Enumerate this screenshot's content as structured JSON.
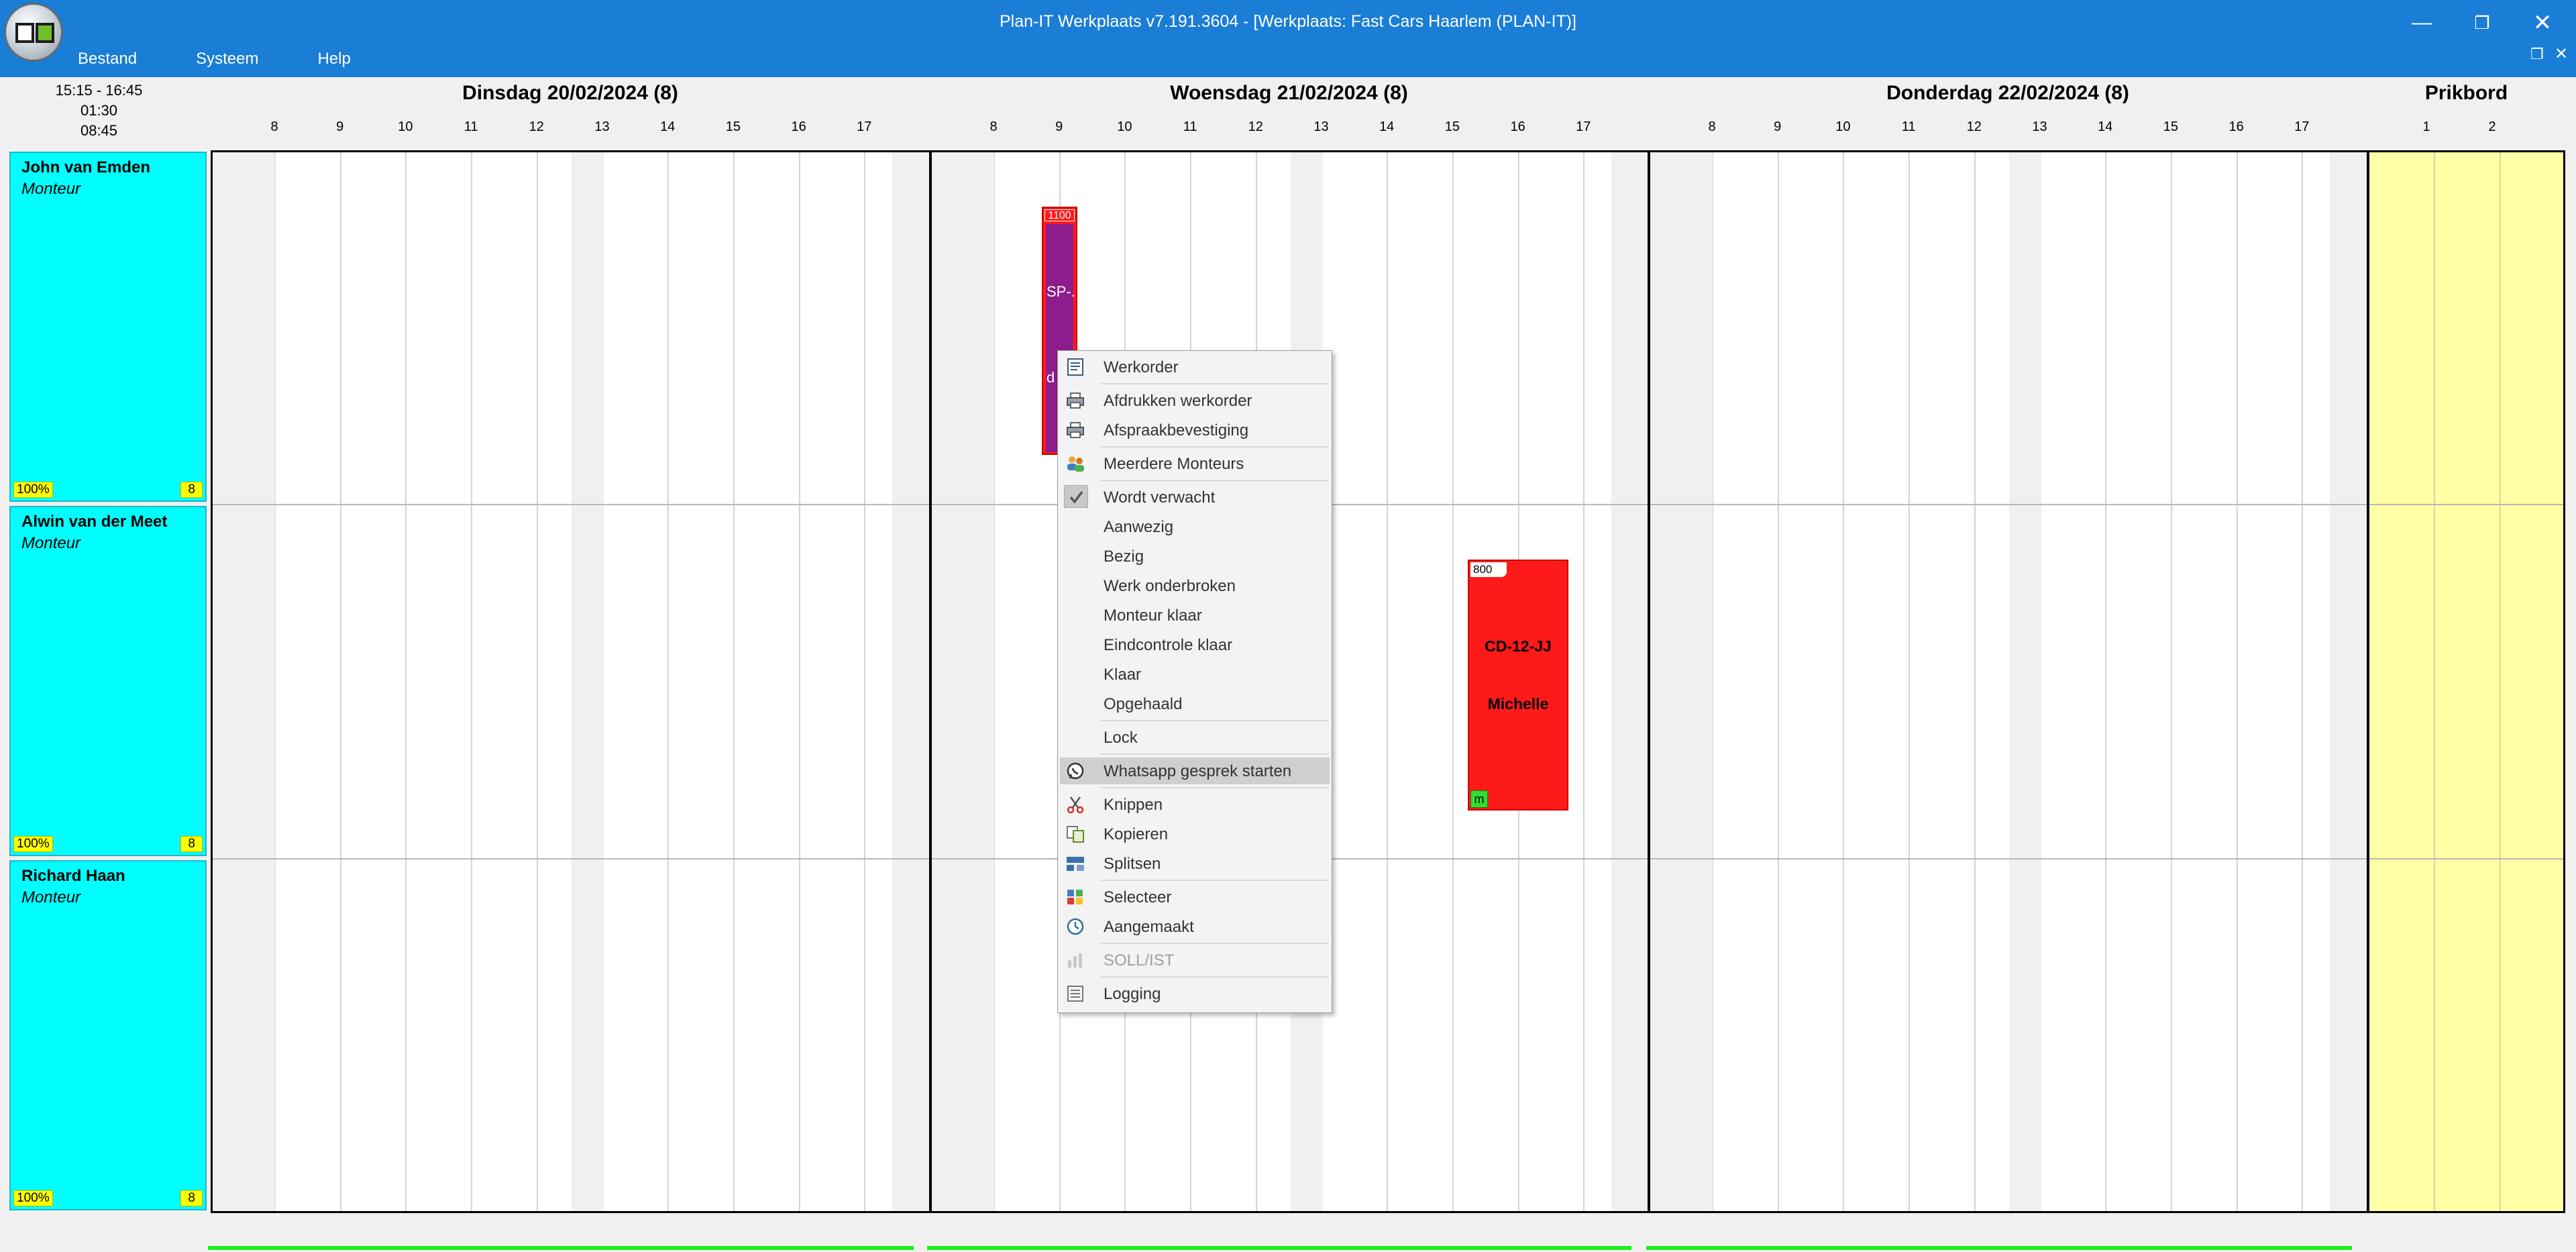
{
  "window": {
    "title": "Plan-IT Werkplaats v7.191.3604 - [Werkplaats: Fast Cars Haarlem (PLAN-IT)]",
    "minimize_glyph": "—",
    "maximize_glyph": "❐",
    "close_glyph": "✕",
    "mdi_restore_glyph": "❐",
    "mdi_close_glyph": "✕"
  },
  "menu": [
    "Bestand",
    "Systeem",
    "Help"
  ],
  "time_info": {
    "range": "15:15 - 16:45",
    "duration": "01:30",
    "current": "08:45"
  },
  "days": [
    {
      "title": "Dinsdag 20/02/2024 (8)",
      "hours": [
        "8",
        "9",
        "10",
        "11",
        "12",
        "13",
        "14",
        "15",
        "16",
        "17"
      ]
    },
    {
      "title": "Woensdag 21/02/2024 (8)",
      "hours": [
        "8",
        "9",
        "10",
        "11",
        "12",
        "13",
        "14",
        "15",
        "16",
        "17"
      ]
    },
    {
      "title": "Donderdag 22/02/2024 (8)",
      "hours": [
        "8",
        "9",
        "10",
        "11",
        "12",
        "13",
        "14",
        "15",
        "16",
        "17"
      ]
    }
  ],
  "prikbord": {
    "title": "Prikbord",
    "columns": [
      "1",
      "2"
    ]
  },
  "mechanics": [
    {
      "name": "John van Emden",
      "role": "Monteur",
      "percent": "100%",
      "hours": "8"
    },
    {
      "name": "Alwin van der Meet",
      "role": "Monteur",
      "percent": "100%",
      "hours": "8"
    },
    {
      "name": "Richard Haan",
      "role": "Monteur",
      "percent": "100%",
      "hours": "8"
    }
  ],
  "appointments": [
    {
      "tag": "1100",
      "plate": "SP-.",
      "customer": "d",
      "fill": "#8d1c8d"
    },
    {
      "tag": "800",
      "plate": "CD-12-JJ",
      "customer": "Michelle",
      "flag": "m",
      "fill": "#ff1a1a"
    }
  ],
  "context_menu": {
    "items": [
      {
        "label": "Werkorder",
        "icon": "workorder-icon"
      },
      {
        "label": "Afdrukken werkorder",
        "icon": "printer-icon"
      },
      {
        "label": "Afspraakbevestiging",
        "icon": "printer-icon"
      },
      {
        "label": "Meerdere Monteurs",
        "icon": "users-icon"
      },
      {
        "label": "Wordt verwacht",
        "icon": "checkmark-icon",
        "checked": true
      },
      {
        "label": "Aanwezig"
      },
      {
        "label": "Bezig"
      },
      {
        "label": "Werk onderbroken"
      },
      {
        "label": "Monteur klaar"
      },
      {
        "label": "Eindcontrole klaar"
      },
      {
        "label": "Klaar"
      },
      {
        "label": "Opgehaald"
      },
      {
        "label": "Lock"
      },
      {
        "label": "Whatsapp gesprek starten",
        "icon": "whatsapp-icon",
        "highlighted": true
      },
      {
        "label": "Knippen",
        "icon": "scissors-icon"
      },
      {
        "label": "Kopieren",
        "icon": "copy-icon"
      },
      {
        "label": "Splitsen",
        "icon": "split-icon"
      },
      {
        "label": "Selecteer",
        "icon": "select-icon"
      },
      {
        "label": "Aangemaakt",
        "icon": "clock-icon"
      },
      {
        "label": "SOLL/IST",
        "icon": "chart-icon",
        "disabled": true
      },
      {
        "label": "Logging",
        "icon": "log-icon"
      }
    ]
  },
  "colors": {
    "titlebar": "#1a7dd6",
    "mechanic_panel": "#00ffff",
    "badge": "#ffff00",
    "appointment": "#ff1a1a",
    "prikbord": "#ffffa6",
    "status_bar": "#22ee22"
  }
}
